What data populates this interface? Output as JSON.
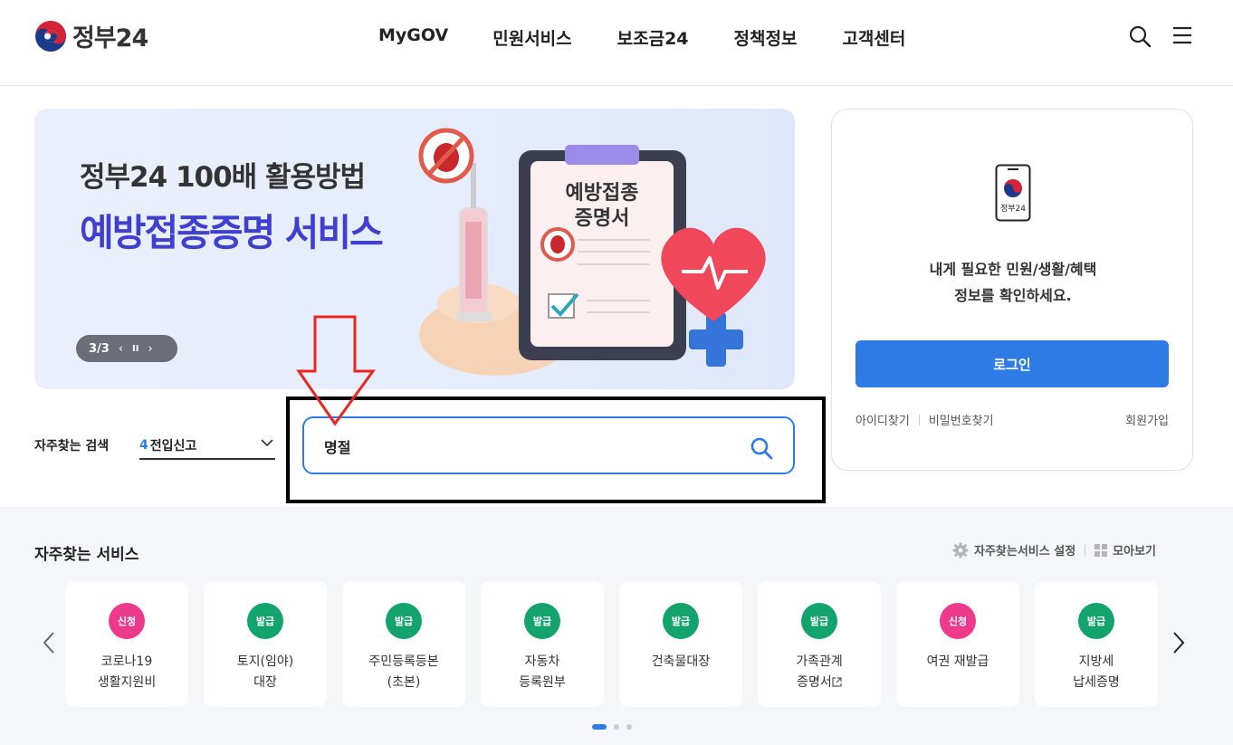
{
  "header": {
    "logo_text": "정부24",
    "nav": [
      "MyGOV",
      "민원서비스",
      "보조금24",
      "정책정보",
      "고객센터"
    ]
  },
  "banner": {
    "title_line1": "정부24 100배 활용방법",
    "title_line2": "예방접종증명 서비스",
    "card_text_line1": "예방접종",
    "card_text_line2": "증명서",
    "slide_counter": "3/3",
    "prev": "‹",
    "pause": "II",
    "next": "›"
  },
  "login": {
    "icon_label": "정부24",
    "message_line1": "내게 필요한 민원/생활/혜택",
    "message_line2": "정보를 확인하세요.",
    "login_button": "로그인",
    "find_id": "아이디찾기",
    "find_password": "비밀번호찾기",
    "signup": "회원가입"
  },
  "frequent_search": {
    "label": "자주찾는 검색",
    "rank": "4",
    "value": "전입신고"
  },
  "search": {
    "value": "명절"
  },
  "services": {
    "title": "자주찾는 서비스",
    "settings_label": "자주찾는서비스 설정",
    "view_all_label": "모아보기",
    "items": [
      {
        "badge": "신청",
        "line1": "코로나19",
        "line2": "생활지원비"
      },
      {
        "badge": "발급",
        "line1": "토지(임야)",
        "line2": "대장"
      },
      {
        "badge": "발급",
        "line1": "주민등록등본",
        "line2": "(초본)"
      },
      {
        "badge": "발급",
        "line1": "자동차",
        "line2": "등록원부"
      },
      {
        "badge": "발급",
        "line1": "건축물대장",
        "line2": ""
      },
      {
        "badge": "발급",
        "line1": "가족관계",
        "line2": "증명서"
      },
      {
        "badge": "신청",
        "line1": "여권 재발급",
        "line2": ""
      },
      {
        "badge": "발급",
        "line1": "지방세",
        "line2": "납세증명"
      }
    ]
  },
  "colors": {
    "primary": "#2f7be5",
    "banner_title": "#3f3fd0",
    "badge_apply": "#ee3a8c",
    "badge_issue": "#13a36c",
    "annotation": "#e8261f"
  }
}
